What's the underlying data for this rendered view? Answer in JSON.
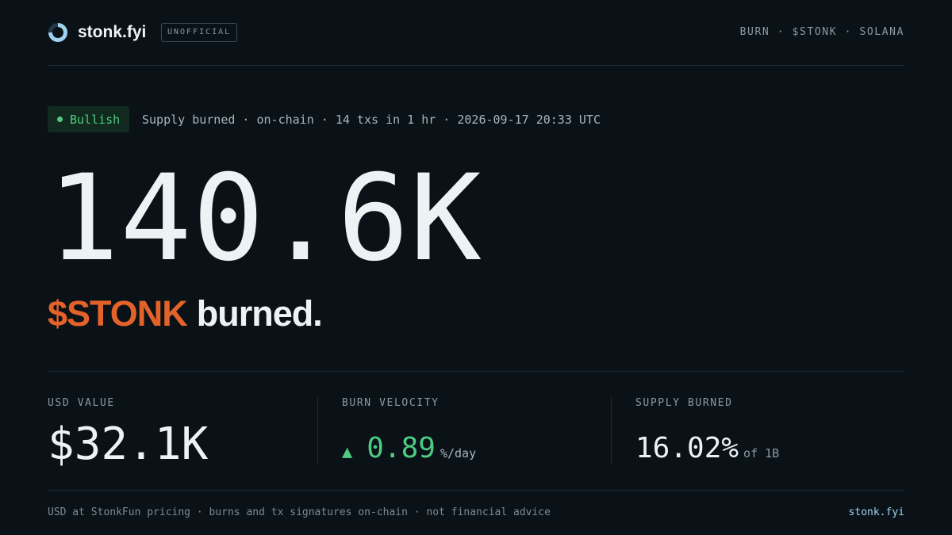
{
  "header": {
    "brand": "stonk.fyi",
    "tag": "UNOFFICIAL",
    "nav": "BURN · $STONK · SOLANA",
    "logo_icon": "ring-logo-icon"
  },
  "status": {
    "badge": "Bullish",
    "line": "Supply burned · on-chain · 14 txs in 1 hr · 2026-09-17 20:33 UTC"
  },
  "hero": {
    "amount": "140.6K",
    "ticker": "$STONK",
    "word": "burned."
  },
  "metrics": {
    "usd": {
      "label": "USD VALUE",
      "value": "$32.1K"
    },
    "velocity": {
      "label": "BURN VELOCITY",
      "arrow": "▲",
      "value": "0.89",
      "unit": "%/day"
    },
    "supply": {
      "label": "SUPPLY BURNED",
      "value": "16.02%",
      "of": "of 1B"
    }
  },
  "footer": {
    "note": "USD at StonkFun pricing · burns and tx signatures on-chain · not financial advice",
    "link": "stonk.fyi"
  },
  "colors": {
    "background": "#0b1217",
    "accent_orange": "#e3622a",
    "bullish_green": "#4ecb82",
    "link_blue": "#9fd2ee"
  }
}
